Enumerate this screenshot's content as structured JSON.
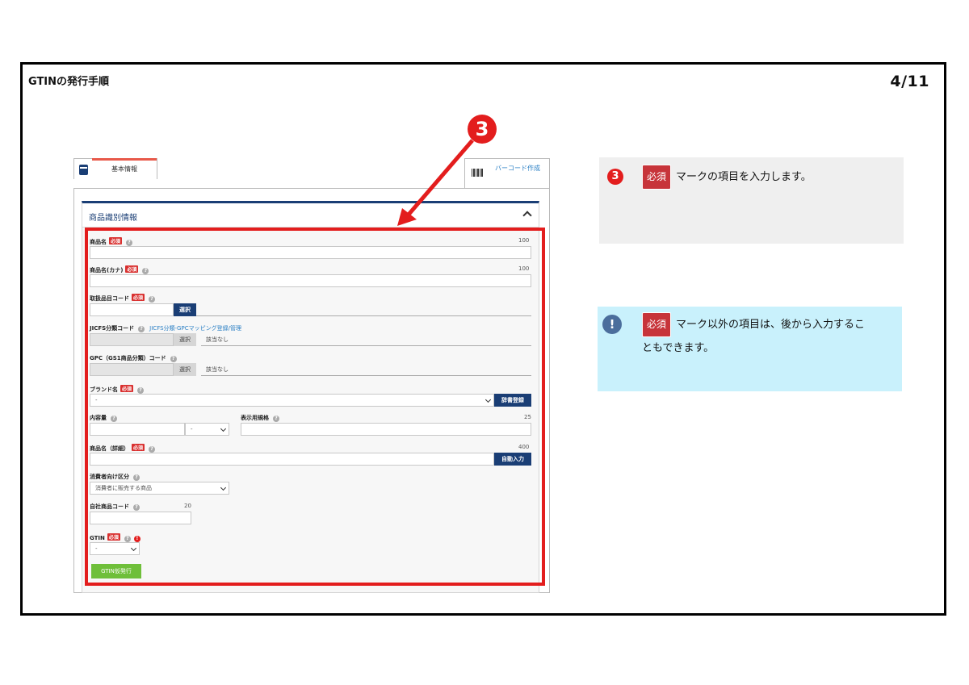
{
  "slide": {
    "title": "GTINの発行手順",
    "page": "4/11"
  },
  "step": {
    "number": "3"
  },
  "tabs": {
    "basic": "基本情報",
    "barcode": "バーコード作成"
  },
  "section": {
    "title": "商品識別情報"
  },
  "badges": {
    "required": "必須",
    "help": "?",
    "warn": "!"
  },
  "fields": {
    "product_name": {
      "label": "商品名",
      "max": "100"
    },
    "product_name_kana": {
      "label": "商品名(カナ)",
      "max": "100"
    },
    "category_code": {
      "label": "取扱品目コード",
      "button": "選択"
    },
    "jicfs": {
      "label": "JICFS分類コード",
      "link": "JICFS分類-GPCマッピング登録/管理",
      "button": "選択",
      "value": "該当なし"
    },
    "gpc": {
      "label": "GPC（GS1商品分類）コード",
      "button": "選択",
      "value": "該当なし"
    },
    "brand": {
      "label": "ブランド名",
      "value": "-",
      "button": "辞書登録"
    },
    "content_amount": {
      "label": "内容量",
      "unit_value": "-"
    },
    "display_spec": {
      "label": "表示用規格",
      "max": "25"
    },
    "product_name_detail": {
      "label": "商品名（詳細）",
      "max": "400",
      "button": "自動入力"
    },
    "consumer_type": {
      "label": "消費者向け区分",
      "value": "消費者に販売する商品"
    },
    "internal_code": {
      "label": "自社商品コード",
      "max": "20"
    },
    "gtin": {
      "label": "GTIN",
      "value": "-",
      "button": "GTIN仮発行"
    }
  },
  "callouts": {
    "first": {
      "badge": "3",
      "req": "必須",
      "text": "マークの項目を入力します。"
    },
    "second": {
      "badge": "!",
      "req": "必須",
      "text_line1": "マーク以外の項目は、後から入力するこ",
      "text_line2": "ともできます。"
    }
  },
  "colors": {
    "accent_red": "#e31d1d",
    "navy": "#1a3e75",
    "green": "#6fbf3a",
    "info_bg": "#c9f1fc",
    "gray_bg": "#efefef"
  }
}
